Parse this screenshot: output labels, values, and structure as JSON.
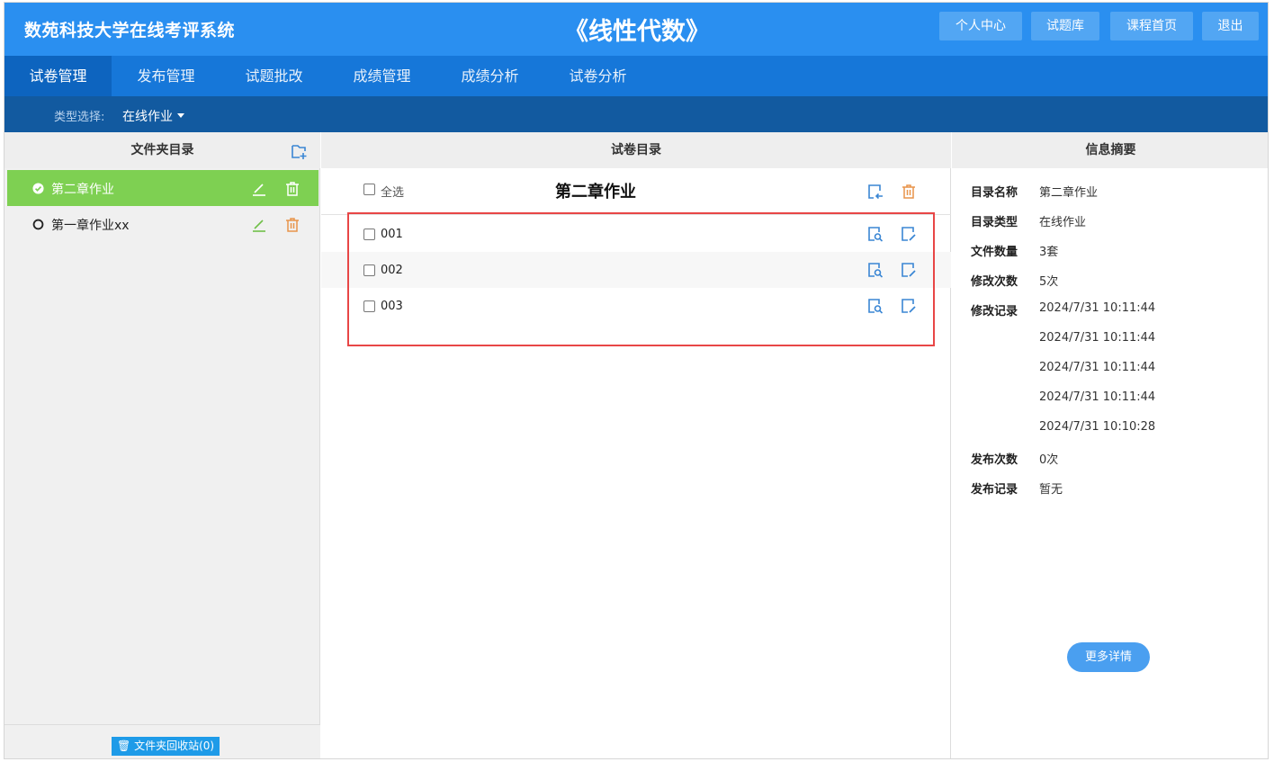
{
  "header": {
    "brand": "数苑科技大学在线考评系统",
    "course_title": "《线性代数》",
    "buttons": [
      "个人中心",
      "试题库",
      "课程首页",
      "退出"
    ]
  },
  "nav": {
    "tabs": [
      "试卷管理",
      "发布管理",
      "试题批改",
      "成绩管理",
      "成绩分析",
      "试卷分析"
    ],
    "active_tab": "试卷管理"
  },
  "type_filter": {
    "label": "类型选择:",
    "value": "在线作业"
  },
  "folder_panel": {
    "title": "文件夹目录",
    "folders": [
      {
        "name": "第二章作业",
        "selected": true
      },
      {
        "name": "第一章作业xx",
        "selected": false
      }
    ],
    "recycle_label": "文件夹回收站(0)"
  },
  "paper_panel": {
    "title": "试卷目录",
    "select_all_label": "全选",
    "current_folder": "第二章作业",
    "papers": [
      "001",
      "002",
      "003"
    ]
  },
  "info_panel": {
    "title": "信息摘要",
    "name_key": "目录名称",
    "name_value": "第二章作业",
    "type_key": "目录类型",
    "type_value": "在线作业",
    "count_key": "文件数量",
    "count_value": "3套",
    "mod_count_key": "修改次数",
    "mod_count_value": "5次",
    "mod_records_key": "修改记录",
    "mod_records": [
      "2024/7/31 10:11:44",
      "2024/7/31 10:11:44",
      "2024/7/31 10:11:44",
      "2024/7/31 10:11:44",
      "2024/7/31 10:10:28"
    ],
    "pub_count_key": "发布次数",
    "pub_count_value": "0次",
    "pub_records_key": "发布记录",
    "pub_records_value": "暂无",
    "more_label": "更多详情"
  },
  "colors": {
    "header_blue": "#2a8ff0",
    "nav_blue": "#1677d9",
    "type_bar_blue": "#125aa0",
    "selected_green": "#7ed052",
    "edit_green": "#6fbf48",
    "delete_orange": "#e8944a",
    "icon_blue": "#3a86d4",
    "highlight_red": "#e84646"
  }
}
